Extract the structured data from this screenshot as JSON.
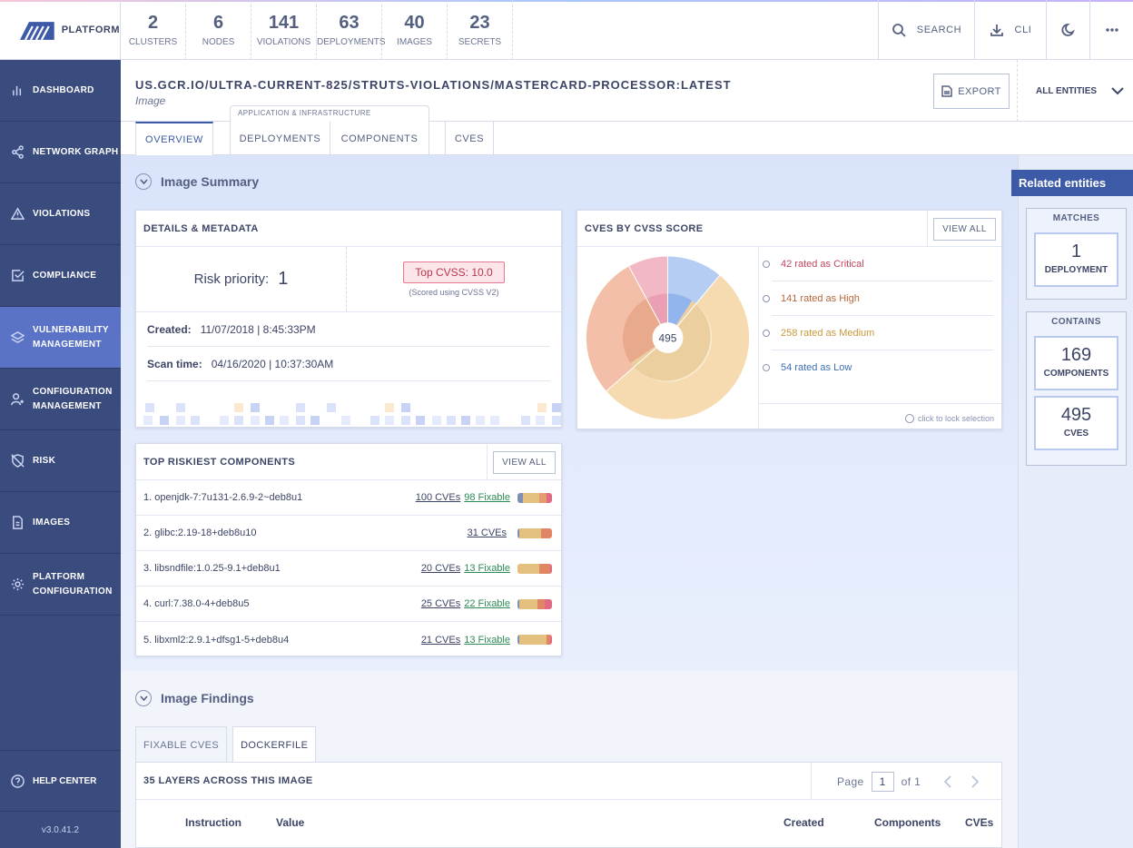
{
  "brand": {
    "name": "PLATFORM"
  },
  "top_counts": [
    {
      "value": "2",
      "label": "CLUSTERS"
    },
    {
      "value": "6",
      "label": "NODES"
    },
    {
      "value": "141",
      "label": "VIOLATIONS"
    },
    {
      "value": "63",
      "label": "DEPLOYMENTS"
    },
    {
      "value": "40",
      "label": "IMAGES"
    },
    {
      "value": "23",
      "label": "SECRETS"
    }
  ],
  "topbar": {
    "search": "SEARCH",
    "cli": "CLI"
  },
  "sidebar": {
    "items": [
      {
        "label": "DASHBOARD",
        "icon": "bar-chart-icon"
      },
      {
        "label": "NETWORK GRAPH",
        "icon": "share-icon"
      },
      {
        "label": "VIOLATIONS",
        "icon": "warning-icon"
      },
      {
        "label": "COMPLIANCE",
        "icon": "checkbox-icon"
      },
      {
        "label": "VULNERABILITY MANAGEMENT",
        "icon": "layers-icon",
        "active": true
      },
      {
        "label": "CONFIGURATION MANAGEMENT",
        "icon": "user-config-icon"
      },
      {
        "label": "RISK",
        "icon": "shield-off-icon"
      },
      {
        "label": "IMAGES",
        "icon": "file-icon"
      },
      {
        "label": "PLATFORM CONFIGURATION",
        "icon": "gear-icon"
      }
    ],
    "help": "HELP CENTER",
    "version": "v3.0.41.2"
  },
  "header": {
    "title": "US.GCR.IO/ULTRA-CURRENT-825/STRUTS-VIOLATIONS/MASTERCARD-PROCESSOR:LATEST",
    "subtitle": "Image",
    "export": "EXPORT",
    "entities": "ALL ENTITIES"
  },
  "tabs": {
    "group_label": "APPLICATION & INFRASTRUCTURE",
    "items": [
      "OVERVIEW",
      "DEPLOYMENTS",
      "COMPONENTS",
      "CVES"
    ]
  },
  "summary": {
    "title": "Image Summary",
    "details": {
      "title": "DETAILS & METADATA",
      "risk_label": "Risk priority:",
      "risk_value": "1",
      "cvss_badge": "Top CVSS: 10.0",
      "cvss_note": "(Scored using CVSS V2)",
      "created_label": "Created:",
      "created_value": "11/07/2018 | 8:45:33PM",
      "scan_label": "Scan time:",
      "scan_value": "04/16/2020 | 10:37:30AM"
    },
    "cvss": {
      "title": "CVES BY CVSS SCORE",
      "view_all": "VIEW ALL",
      "total": "495",
      "legend": [
        {
          "text": "42 rated as Critical",
          "color": "#c0475f"
        },
        {
          "text": "141 rated as High",
          "color": "#b9673b"
        },
        {
          "text": "258 rated as Medium",
          "color": "#c89a3c"
        },
        {
          "text": "54 rated as Low",
          "color": "#3d6fb3"
        }
      ],
      "lock_note": "click to lock selection"
    },
    "components": {
      "title": "TOP RISKIEST COMPONENTS",
      "view_all": "VIEW ALL",
      "rows": [
        {
          "name": "1. openjdk-7:7u131-2.6.9-2~deb8u1",
          "cves": "100 CVEs",
          "fixable": "98 Fixable"
        },
        {
          "name": "2. glibc:2.19-18+deb8u10",
          "cves": "31 CVEs",
          "fixable": ""
        },
        {
          "name": "3. libsndfile:1.0.25-9.1+deb8u1",
          "cves": "20 CVEs",
          "fixable": "13 Fixable"
        },
        {
          "name": "4. curl:7.38.0-4+deb8u5",
          "cves": "25 CVEs",
          "fixable": "22 Fixable"
        },
        {
          "name": "5. libxml2:2.9.1+dfsg1-5+deb8u4",
          "cves": "21 CVEs",
          "fixable": "13 Fixable"
        }
      ]
    }
  },
  "findings": {
    "title": "Image Findings",
    "tabs": [
      "FIXABLE CVES",
      "DOCKERFILE"
    ],
    "layers_title": "35 LAYERS ACROSS THIS IMAGE",
    "page_label": "Page",
    "page_value": "1",
    "page_of": "of 1",
    "columns": [
      "Instruction",
      "Value",
      "Created",
      "Components",
      "CVEs"
    ]
  },
  "related": {
    "title": "Related entities",
    "matches_label": "MATCHES",
    "matches": [
      {
        "value": "1",
        "label": "DEPLOYMENT"
      }
    ],
    "contains_label": "CONTAINS",
    "contains": [
      {
        "value": "169",
        "label": "COMPONENTS"
      },
      {
        "value": "495",
        "label": "CVES"
      }
    ]
  }
}
